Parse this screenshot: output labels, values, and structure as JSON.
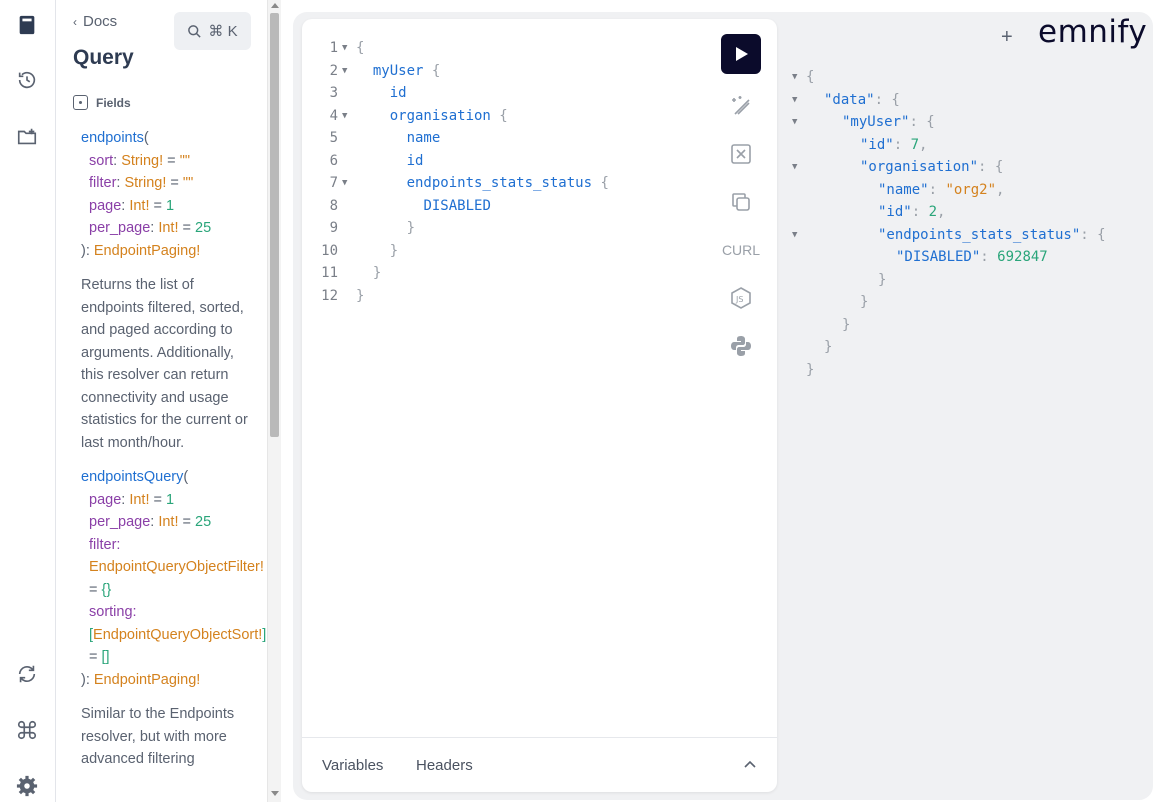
{
  "docs": {
    "back_label": "Docs",
    "search_shortcut": "⌘ K",
    "title": "Query",
    "fields_label": "Fields",
    "endpoints": {
      "name": "endpoints",
      "args": [
        {
          "name": "sort",
          "type": "String!",
          "default": "\"\""
        },
        {
          "name": "filter",
          "type": "String!",
          "default": "\"\""
        },
        {
          "name": "page",
          "type": "Int!",
          "default": "1"
        },
        {
          "name": "per_page",
          "type": "Int!",
          "default": "25"
        }
      ],
      "return_type": "EndpointPaging!",
      "description": "Returns the list of endpoints filtered, sorted, and paged according to arguments. Additionally, this resolver can return connectivity and usage statistics for the current or last month/hour."
    },
    "endpointsQuery": {
      "name": "endpointsQuery",
      "page_arg": "page",
      "page_type": "Int!",
      "page_default": "1",
      "per_page_arg": "per_page",
      "per_page_type": "Int!",
      "per_page_default": "25",
      "filter_arg": "filter:",
      "filter_type": "EndpointQueryObjectFilter!",
      "filter_default": "{}",
      "sorting_arg": "sorting:",
      "sorting_type": "EndpointQueryObjectSort!",
      "sorting_default": "[]",
      "return_type": "EndpointPaging!",
      "description": "Similar to the Endpoints resolver, but with more advanced filtering"
    }
  },
  "editor": {
    "lines": [
      {
        "n": "1",
        "fold": true,
        "text": "{"
      },
      {
        "n": "2",
        "fold": true,
        "text": "  myUser {"
      },
      {
        "n": "3",
        "fold": false,
        "text": "    id"
      },
      {
        "n": "4",
        "fold": true,
        "text": "    organisation {"
      },
      {
        "n": "5",
        "fold": false,
        "text": "      name"
      },
      {
        "n": "6",
        "fold": false,
        "text": "      id"
      },
      {
        "n": "7",
        "fold": true,
        "text": "      endpoints_stats_status {"
      },
      {
        "n": "8",
        "fold": false,
        "text": "        DISABLED"
      },
      {
        "n": "9",
        "fold": false,
        "text": "      }"
      },
      {
        "n": "10",
        "fold": false,
        "text": "    }"
      },
      {
        "n": "11",
        "fold": false,
        "text": "  }"
      },
      {
        "n": "12",
        "fold": false,
        "text": "}"
      }
    ],
    "curl_label": "CURL",
    "variables_tab": "Variables",
    "headers_tab": "Headers"
  },
  "header": {
    "plus": "+",
    "logo": "emnify"
  },
  "result": {
    "lines": [
      {
        "fold": true,
        "indent": 0,
        "parts": [
          [
            "br",
            "{"
          ]
        ]
      },
      {
        "fold": true,
        "indent": 1,
        "parts": [
          [
            "key",
            "\"data\""
          ],
          [
            "br",
            ": {"
          ]
        ]
      },
      {
        "fold": true,
        "indent": 2,
        "parts": [
          [
            "key",
            "\"myUser\""
          ],
          [
            "br",
            ": {"
          ]
        ]
      },
      {
        "fold": false,
        "indent": 3,
        "parts": [
          [
            "key",
            "\"id\""
          ],
          [
            "br",
            ": "
          ],
          [
            "numv",
            "7"
          ],
          [
            "br",
            ","
          ]
        ]
      },
      {
        "fold": true,
        "indent": 3,
        "parts": [
          [
            "key",
            "\"organisation\""
          ],
          [
            "br",
            ": {"
          ]
        ]
      },
      {
        "fold": false,
        "indent": 4,
        "parts": [
          [
            "key",
            "\"name\""
          ],
          [
            "br",
            ": "
          ],
          [
            "str",
            "\"org2\""
          ],
          [
            "br",
            ","
          ]
        ]
      },
      {
        "fold": false,
        "indent": 4,
        "parts": [
          [
            "key",
            "\"id\""
          ],
          [
            "br",
            ": "
          ],
          [
            "numv",
            "2"
          ],
          [
            "br",
            ","
          ]
        ]
      },
      {
        "fold": true,
        "indent": 4,
        "parts": [
          [
            "key",
            "\"endpoints_stats_status\""
          ],
          [
            "br",
            ": {"
          ]
        ]
      },
      {
        "fold": false,
        "indent": 5,
        "parts": [
          [
            "key",
            "\"DISABLED\""
          ],
          [
            "br",
            ": "
          ],
          [
            "numv",
            "692847"
          ]
        ]
      },
      {
        "fold": false,
        "indent": 4,
        "parts": [
          [
            "br",
            "}"
          ]
        ]
      },
      {
        "fold": false,
        "indent": 3,
        "parts": [
          [
            "br",
            "}"
          ]
        ]
      },
      {
        "fold": false,
        "indent": 2,
        "parts": [
          [
            "br",
            "}"
          ]
        ]
      },
      {
        "fold": false,
        "indent": 1,
        "parts": [
          [
            "br",
            "}"
          ]
        ]
      },
      {
        "fold": false,
        "indent": 0,
        "parts": [
          [
            "br",
            "}"
          ]
        ]
      }
    ]
  }
}
